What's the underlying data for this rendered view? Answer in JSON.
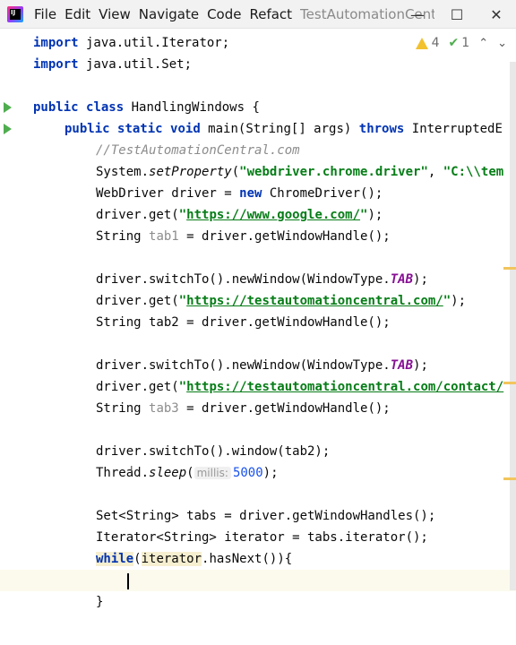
{
  "window": {
    "menu": [
      "File",
      "Edit",
      "View",
      "Navigate",
      "Code",
      "Refact"
    ],
    "project_title": "TestAutomationCentral",
    "controls": {
      "minimize": "—",
      "maximize": "☐",
      "close": "✕"
    }
  },
  "inspection": {
    "warnings": "4",
    "ok_count": "1"
  },
  "editor": {
    "lines": {
      "l1": {
        "kw": "import",
        "rest": " java.util.Iterator;"
      },
      "l2": {
        "kw": "import",
        "rest": " java.util.Set;"
      },
      "l4": {
        "kw1": "public",
        "kw2": "class",
        "rest": " HandlingWindows {"
      },
      "l5": {
        "kw1": "public",
        "kw2": "static",
        "kw3": "void",
        "rest": " main(String[] args) ",
        "kw4": "throws",
        "rest2": " InterruptedE"
      },
      "l6": {
        "comment": "//TestAutomationCentral.com"
      },
      "l7": {
        "a": "System.",
        "m": "setProperty",
        "b": "(",
        "s1": "\"webdriver.chrome.driver\"",
        "c": ", ",
        "s2": "\"C:\\\\tem"
      },
      "l8": {
        "a": "WebDriver driver = ",
        "kw": "new",
        "b": " ChromeDriver();"
      },
      "l9": {
        "a": "driver.get(",
        "q1": "\"",
        "url": "https://www.google.com/",
        "q2": "\"",
        "b": ");"
      },
      "l10": {
        "a": "String ",
        "var": "tab1",
        "b": " = driver.getWindowHandle();"
      },
      "l12": {
        "a": "driver.switchTo().newWindow(WindowType.",
        "f": "TAB",
        "b": ");"
      },
      "l13": {
        "a": "driver.get(",
        "q1": "\"",
        "url": "https://testautomationcentral.com/",
        "q2": "\"",
        "b": ");"
      },
      "l14": {
        "a": "String tab2 = driver.getWindowHandle();"
      },
      "l16": {
        "a": "driver.switchTo().newWindow(WindowType.",
        "f": "TAB",
        "b": ");"
      },
      "l17": {
        "a": "driver.get(",
        "q1": "\"",
        "url": "https://testautomationcentral.com/contact/"
      },
      "l18": {
        "a": "String ",
        "var": "tab3",
        "b": " = driver.getWindowHandle();"
      },
      "l20": {
        "a": "driver.switchTo().window(tab2);"
      },
      "l21": {
        "a": "Thread.",
        "m": "sleep",
        "b": "(",
        "hint": "millis:",
        "num": "5000",
        "c": ");"
      },
      "l23": {
        "a": "Set<String> tabs = driver.getWindowHandles();"
      },
      "l24": {
        "a": "Iterator<String> iterator = tabs.iterator();"
      },
      "l25": {
        "kw": "while",
        "b": "(",
        "w": "iterator",
        "c": ".hasNext()){"
      },
      "l27": {
        "a": "}"
      }
    }
  },
  "colors": {
    "keyword": "#0033b3",
    "string": "#067d17",
    "comment": "#8c8c8c",
    "field": "#871094",
    "number": "#1750eb",
    "run_gutter": "#4fad4f",
    "warning": "#f2c12e"
  }
}
